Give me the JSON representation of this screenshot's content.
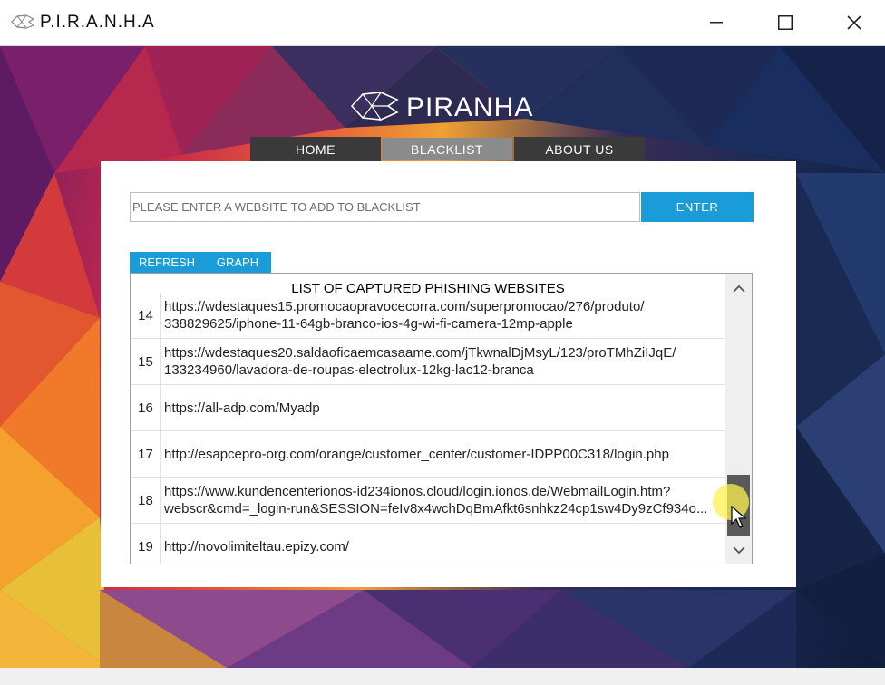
{
  "window": {
    "title": "P.I.R.A.N.H.A",
    "minimize_icon": "minimize-icon",
    "maximize_icon": "maximize-icon",
    "close_icon": "close-icon"
  },
  "logo": {
    "text": "PIRANHA",
    "icon": "piranha-fish-icon"
  },
  "nav": {
    "tabs": [
      {
        "label": "HOME"
      },
      {
        "label": "BLACKLIST",
        "active": true
      },
      {
        "label": "ABOUT US"
      }
    ]
  },
  "blacklist_form": {
    "placeholder": "PLEASE ENTER A WEBSITE TO ADD TO BLACKLIST",
    "value": "",
    "enter_label": "ENTER"
  },
  "toolbar": {
    "refresh_label": "REFRESH",
    "graph_label": "GRAPH"
  },
  "list": {
    "header": "LIST OF CAPTURED PHISHING WEBSITES",
    "rows": [
      {
        "num": "14",
        "url": "https://wdestaques15.promocaopravocecorra.com/superpromocao/276/produto/\n338829625/iphone-11-64gb-branco-ios-4g-wi-fi-camera-12mp-apple"
      },
      {
        "num": "15",
        "url": "https://wdestaques20.saldaoficaemcasaame.com/jTkwnalDjMsyL/123/proTMhZiIJqE/\n133234960/lavadora-de-roupas-electrolux-12kg-lac12-branca"
      },
      {
        "num": "16",
        "url": "https://all-adp.com/Myadp"
      },
      {
        "num": "17",
        "url": "http://esapcepro-org.com/orange/customer_center/customer-IDPP00C318/login.php"
      },
      {
        "num": "18",
        "url": "https://www.kundencenterionos-id234ionos.cloud/login.ionos.de/WebmailLogin.htm?\nwebscr&cmd=_login-run&SESSION=feIv8x4wchDqBmAfkt6snhkz24cp1sw4Dy9zCf934o..."
      },
      {
        "num": "19",
        "url": "http://novolimiteltau.epizy.com/"
      }
    ],
    "scroll_up_icon": "chevron-up-icon",
    "scroll_down_icon": "chevron-down-icon"
  },
  "colors": {
    "accent": "#1a9cd8",
    "tab_dark": "#3a3a3a",
    "tab_active": "#8b8b8b"
  }
}
